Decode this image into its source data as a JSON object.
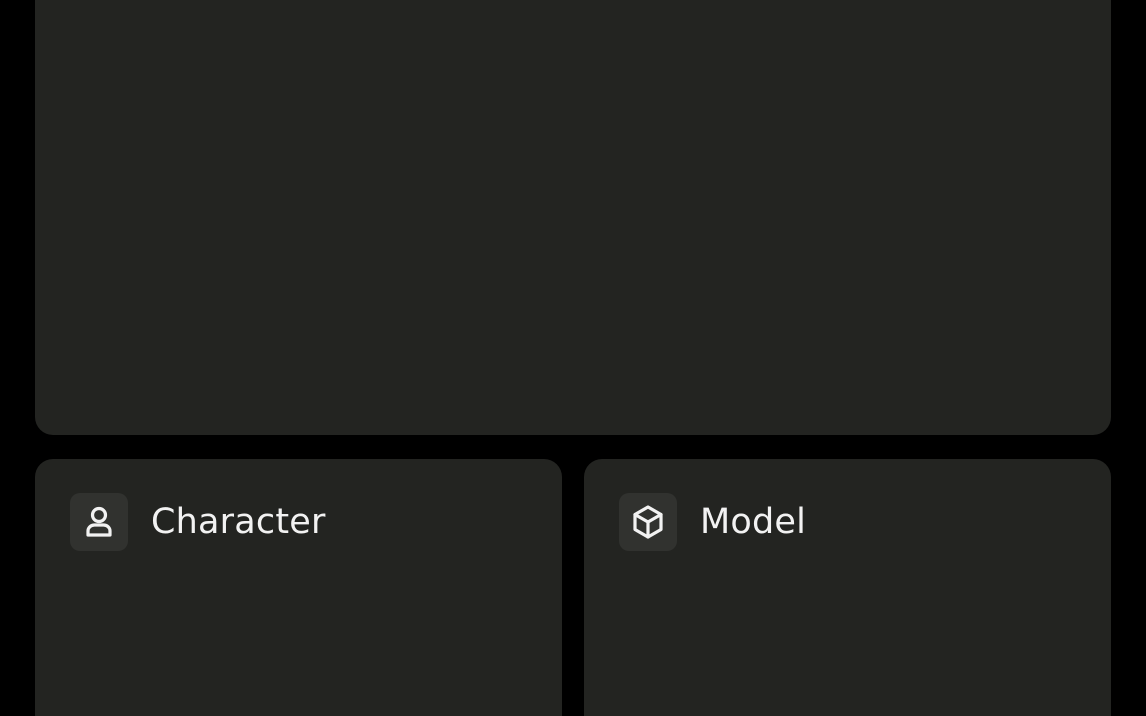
{
  "cards": [
    {
      "label": "Character",
      "icon": "person-icon"
    },
    {
      "label": "Model",
      "icon": "cube-icon"
    }
  ],
  "colors": {
    "background": "#000000",
    "panel": "#232421",
    "icon_box": "#31322f",
    "text": "#f2f2f2"
  }
}
